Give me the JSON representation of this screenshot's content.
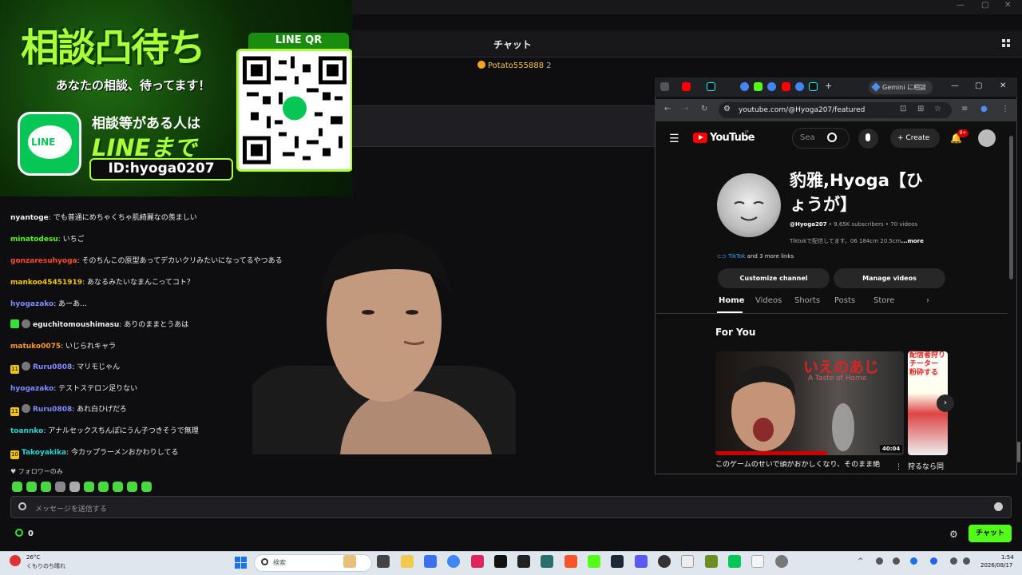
{
  "chat": {
    "title": "チャット",
    "gift_user": "Potato555888",
    "gift_count": "2",
    "messages": [
      {
        "user": "nyantoge",
        "color": "#efeff1",
        "badges": [],
        "text": ": でも普通にめちゃくちゃ肌綺麗なの羨ましい"
      },
      {
        "user": "minatodesu",
        "color": "#53fc18",
        "badges": [],
        "text": ": いちご"
      },
      {
        "user": "gonzaresuhyoga",
        "color": "#ff4a2b",
        "badges": [],
        "text": ": そのちんこの原型あってデカいクリみたいになってるやつある"
      },
      {
        "user": "mankoo45451919",
        "color": "#f1c40f",
        "badges": [],
        "text": ": あなるみたいなまんこってコト？"
      },
      {
        "user": "hyogazako",
        "color": "#7f8cff",
        "badges": [],
        "text": ": あーあ..."
      },
      {
        "user": "eguchitomoushimasu",
        "color": "#efeff1",
        "badges": [
          "green",
          "av"
        ],
        "text": ": ありのままとうあは"
      },
      {
        "user": "matuko0075",
        "color": "#ff9a2b",
        "badges": [],
        "text": ": いじられキャラ"
      },
      {
        "user": "Ruru0808",
        "color": "#7f8cff",
        "badges": [
          "sub:11",
          "av"
        ],
        "text": ": マリモじゃん"
      },
      {
        "user": "hyogazako",
        "color": "#7f8cff",
        "badges": [],
        "text": ": テストステロン足りない"
      },
      {
        "user": "Ruru0808",
        "color": "#7f8cff",
        "badges": [
          "sub:11",
          "av"
        ],
        "text": ": あれ白ひげだろ"
      },
      {
        "user": "toannko",
        "color": "#2bd4d4",
        "badges": [],
        "text": ": アナルセックスちんぽにうん子つきそうで無理"
      },
      {
        "user": "Takoyakika",
        "color": "#2bd4d4",
        "badges": [
          "sub:10"
        ],
        "text": ": 今カップラーメンおかわりしてる"
      }
    ],
    "followers_only": "フォロワーのみ",
    "input_placeholder": "メッセージを送信する",
    "points": "0",
    "send_label": "チャット"
  },
  "promo": {
    "title": "相談凸待ち",
    "subtitle": "あなたの相談、待ってます！",
    "line_logo_text": "LINE",
    "consult_text": "相談等がある人は",
    "line_text": "LINEまで",
    "line_id": "ID:hyoga0207",
    "qr_label": "LINE QR"
  },
  "browser": {
    "gemini_tab": "Gemini に相談",
    "url": "youtube.com/@Hyoga207/featured"
  },
  "youtube": {
    "brand": "YouTube",
    "region": "JP",
    "search_placeholder": "Sea",
    "create_label": "Create",
    "notification_badge": "9+",
    "channel_name": "豹雅,Hyoga【ひょうが】",
    "handle": "@Hyoga207",
    "stats": " • 9.65K subscribers • 70 videos",
    "description": "Tiktokで配信してます。06 184cm 20.5cm",
    "more": "...more",
    "link_tiktok": "TikTok",
    "link_more": " and 3 more links",
    "customize_label": "Customize channel",
    "manage_label": "Manage videos",
    "tabs": [
      "Home",
      "Videos",
      "Shorts",
      "Posts",
      "Store"
    ],
    "section_title": "For You",
    "video1": {
      "thumb_title": "いえのあじ",
      "thumb_sub": "A Taste of Home",
      "duration": "40:04",
      "title": "このゲームのせいで頭がおかしくなり、そのまま絶"
    },
    "video2": {
      "thumb_title": "配信者狩り チーター 粉砕する",
      "title": "狩るなら同"
    }
  },
  "taskbar": {
    "weather_temp": "26°C",
    "weather_desc": "くもりのち晴れ",
    "search_placeholder": "検索",
    "time": "1:54",
    "date": "2026/08/17"
  },
  "colors": {
    "kick_green": "#53fc18",
    "youtube_red": "#ff0000",
    "line_green": "#06c755"
  }
}
